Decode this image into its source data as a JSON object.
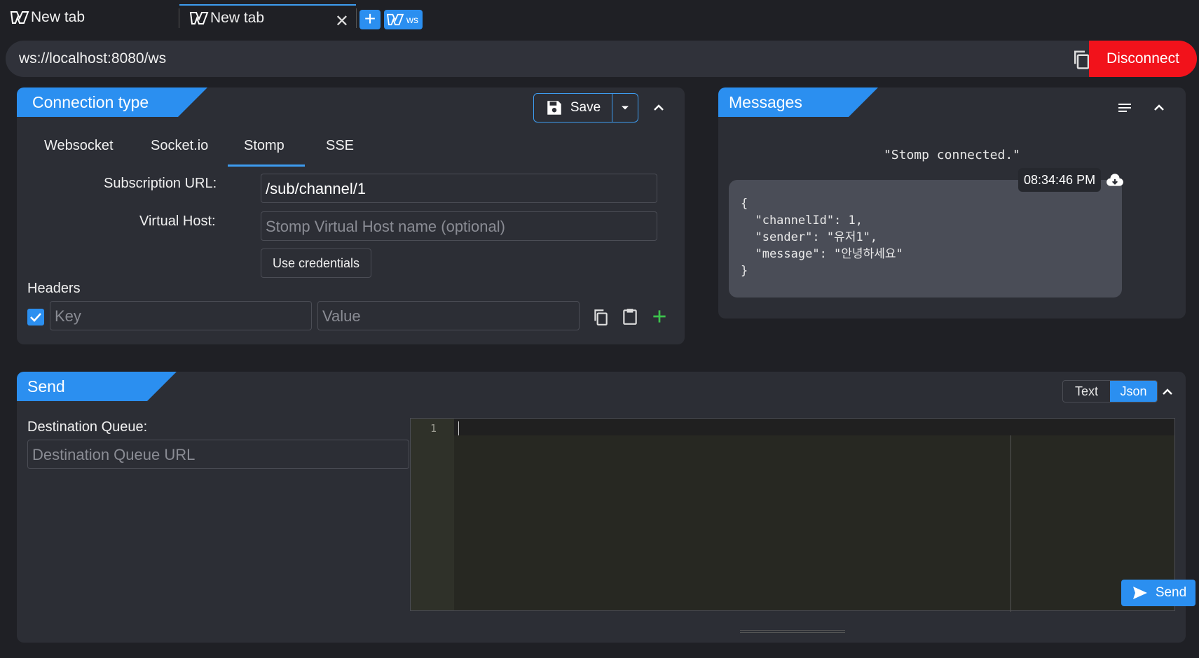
{
  "tabs": [
    {
      "label": "New tab",
      "active": false
    },
    {
      "label": "New tab",
      "active": true,
      "close": "✕"
    }
  ],
  "tabbar": {
    "ws_label": "ws"
  },
  "url": {
    "value": "ws://localhost:8080/ws",
    "disconnect_label": "Disconnect"
  },
  "connection": {
    "title": "Connection type",
    "save_label": "Save",
    "subtabs": [
      "Websocket",
      "Socket.io",
      "Stomp",
      "SSE"
    ],
    "active_subtab": "Stomp",
    "subscription_label": "Subscription URL:",
    "subscription_value": "/sub/channel/1",
    "vhost_label": "Virtual Host:",
    "vhost_placeholder": "Stomp Virtual Host name (optional)",
    "credentials_label": "Use credentials",
    "headers_label": "Headers",
    "key_placeholder": "Key",
    "value_placeholder": "Value"
  },
  "messages": {
    "title": "Messages",
    "status": "\"Stomp connected.\"",
    "time": "08:34:46 PM",
    "body": "{\n  \"channelId\": 1,\n  \"sender\": \"유저1\",\n  \"message\": \"안녕하세요\"\n}"
  },
  "send": {
    "title": "Send",
    "mode_text": "Text",
    "mode_json": "Json",
    "destination_label": "Destination Queue:",
    "destination_placeholder": "Destination Queue URL",
    "line_number": "1",
    "send_label": "Send"
  },
  "colors": {
    "accent": "#2b8ff0",
    "danger": "#f2121b",
    "panel": "#2c2e35",
    "background": "#1f2025",
    "add": "#3cc24c"
  }
}
